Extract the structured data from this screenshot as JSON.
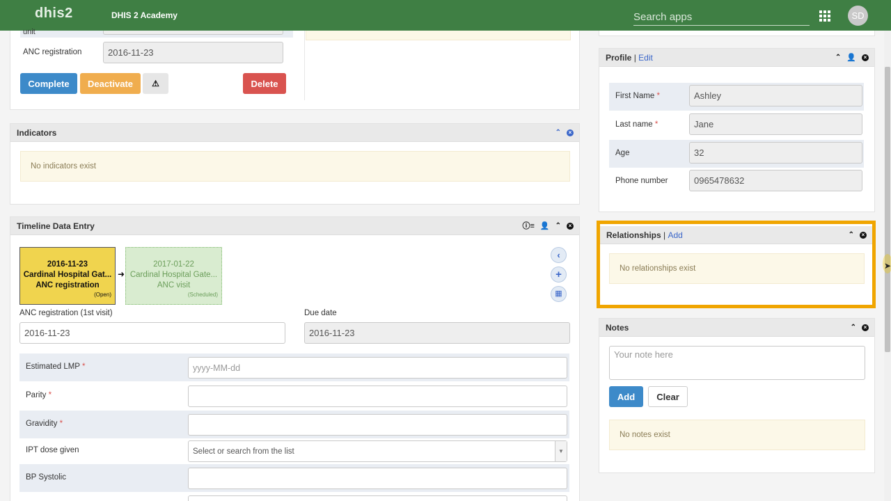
{
  "header": {
    "logo": "dhis2",
    "institution": "DHIS 2 Academy",
    "search_placeholder": "Search apps",
    "avatar_initials": "SD"
  },
  "enrollment": {
    "cut_label": "unit",
    "anc_registration_label": "ANC registration",
    "anc_registration_value": "2016-11-23",
    "buttons": {
      "complete": "Complete",
      "deactivate": "Deactivate",
      "delete": "Delete"
    }
  },
  "indicators": {
    "title": "Indicators",
    "empty": "No indicators exist"
  },
  "timeline": {
    "title": "Timeline Data Entry",
    "events": [
      {
        "date": "2016-11-23",
        "org": "Cardinal Hospital Gat...",
        "stage": "ANC registration",
        "status": "(Open)"
      },
      {
        "date": "2017-01-22",
        "org": "Cardinal Hospital Gate...",
        "stage": "ANC visit",
        "status": "(Scheduled)"
      }
    ],
    "event_date_label": "ANC registration (1st visit)",
    "event_date_value": "2016-11-23",
    "due_date_label": "Due date",
    "due_date_value": "2016-11-23",
    "fields": [
      {
        "label": "Estimated LMP",
        "required": "*",
        "placeholder": "yyyy-MM-dd"
      },
      {
        "label": "Parity",
        "required": "*",
        "placeholder": ""
      },
      {
        "label": "Gravidity",
        "required": "*",
        "placeholder": ""
      },
      {
        "label": "IPT dose given",
        "required": "",
        "placeholder": "Select or search from the list"
      },
      {
        "label": "BP Systolic",
        "required": "",
        "placeholder": ""
      }
    ]
  },
  "profile": {
    "title": "Profile",
    "edit": "Edit",
    "separator": "|",
    "fields": [
      {
        "label": "First Name",
        "required": "*",
        "value": "Ashley"
      },
      {
        "label": "Last name",
        "required": "*",
        "value": "Jane"
      },
      {
        "label": "Age",
        "required": "",
        "value": "32"
      },
      {
        "label": "Phone number",
        "required": "",
        "value": "0965478632"
      }
    ]
  },
  "relationships": {
    "title": "Relationships",
    "add": "Add",
    "separator": "|",
    "empty": "No relationships exist",
    "highlight_color": "#f0a500"
  },
  "notes": {
    "title": "Notes",
    "placeholder": "Your note here",
    "add": "Add",
    "clear": "Clear",
    "empty": "No notes exist"
  },
  "colors": {
    "header": "#3f7f44",
    "complete": "#3d8ac9",
    "deactivate": "#f0ad4e",
    "delete": "#d9534f",
    "active_event": "#f0d44e",
    "scheduled_event": "#d9ecd0"
  }
}
